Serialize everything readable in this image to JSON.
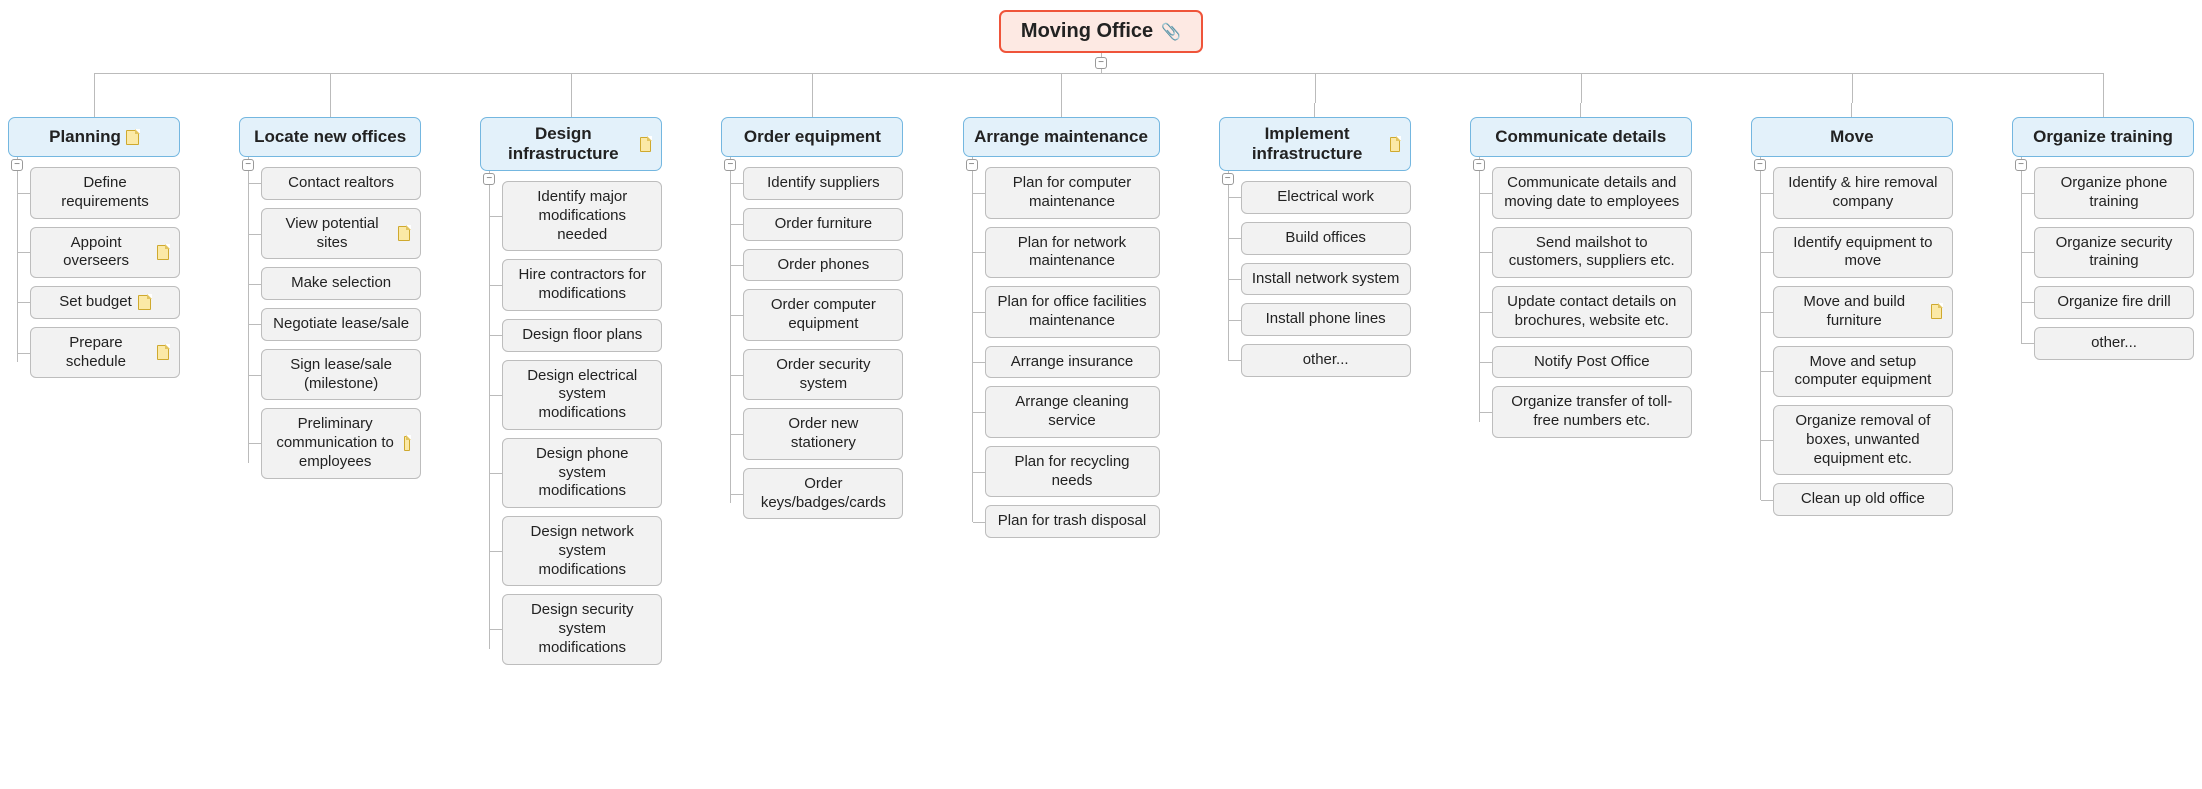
{
  "root": {
    "label": "Moving Office",
    "has_attachment": true
  },
  "colors": {
    "root_bg": "#fde9e3",
    "root_border": "#ef543a",
    "branch_bg": "#e3f1fa",
    "branch_border": "#74b7e0",
    "leaf_bg": "#f2f2f2",
    "leaf_border": "#bdbdbd",
    "connector": "#bbbbbb",
    "note_bg": "#fbe9a6",
    "note_border": "#cfa92e"
  },
  "branches": [
    {
      "label": "Planning",
      "has_note": true,
      "children": [
        {
          "label": "Define requirements"
        },
        {
          "label": "Appoint overseers",
          "has_note": true
        },
        {
          "label": "Set budget",
          "has_note": true
        },
        {
          "label": "Prepare schedule",
          "has_note": true
        }
      ]
    },
    {
      "label": "Locate new offices",
      "children": [
        {
          "label": "Contact realtors"
        },
        {
          "label": "View potential sites",
          "has_note": true
        },
        {
          "label": "Make selection"
        },
        {
          "label": "Negotiate lease/sale"
        },
        {
          "label": "Sign lease/sale (milestone)"
        },
        {
          "label": "Preliminary communication to employees",
          "has_note": true
        }
      ]
    },
    {
      "label": "Design infrastructure",
      "has_note": true,
      "children": [
        {
          "label": "Identify major modifications needed"
        },
        {
          "label": "Hire contractors for modifications"
        },
        {
          "label": "Design floor plans"
        },
        {
          "label": "Design electrical system modifications"
        },
        {
          "label": "Design phone system modifications"
        },
        {
          "label": "Design network system modifications"
        },
        {
          "label": "Design security system modifications"
        }
      ]
    },
    {
      "label": "Order equipment",
      "children": [
        {
          "label": "Identify suppliers"
        },
        {
          "label": "Order furniture"
        },
        {
          "label": "Order phones"
        },
        {
          "label": "Order computer equipment"
        },
        {
          "label": "Order security system"
        },
        {
          "label": "Order new stationery"
        },
        {
          "label": "Order keys/badges/cards"
        }
      ]
    },
    {
      "label": "Arrange maintenance",
      "children": [
        {
          "label": "Plan for computer maintenance"
        },
        {
          "label": "Plan for network maintenance"
        },
        {
          "label": "Plan for office facilities maintenance"
        },
        {
          "label": "Arrange insurance"
        },
        {
          "label": "Arrange cleaning service"
        },
        {
          "label": "Plan for recycling needs"
        },
        {
          "label": "Plan for trash disposal"
        }
      ]
    },
    {
      "label": "Implement infrastructure",
      "has_note": true,
      "children": [
        {
          "label": "Electrical work"
        },
        {
          "label": "Build offices"
        },
        {
          "label": "Install network system"
        },
        {
          "label": "Install phone lines"
        },
        {
          "label": "other..."
        }
      ]
    },
    {
      "label": "Communicate details",
      "children": [
        {
          "label": "Communicate details and moving date to employees"
        },
        {
          "label": "Send mailshot to customers, suppliers etc."
        },
        {
          "label": "Update contact details on brochures, website etc."
        },
        {
          "label": "Notify Post Office"
        },
        {
          "label": "Organize transfer of toll-free numbers etc."
        }
      ]
    },
    {
      "label": "Move",
      "children": [
        {
          "label": "Identify & hire removal company"
        },
        {
          "label": "Identify equipment to move"
        },
        {
          "label": "Move and build furniture",
          "has_note": true
        },
        {
          "label": "Move and setup computer equipment"
        },
        {
          "label": "Organize removal of boxes, unwanted equipment etc."
        },
        {
          "label": "Clean up old office"
        }
      ]
    },
    {
      "label": "Organize training",
      "children": [
        {
          "label": "Organize phone training"
        },
        {
          "label": "Organize security training"
        },
        {
          "label": "Organize fire drill"
        },
        {
          "label": "other..."
        }
      ]
    }
  ]
}
